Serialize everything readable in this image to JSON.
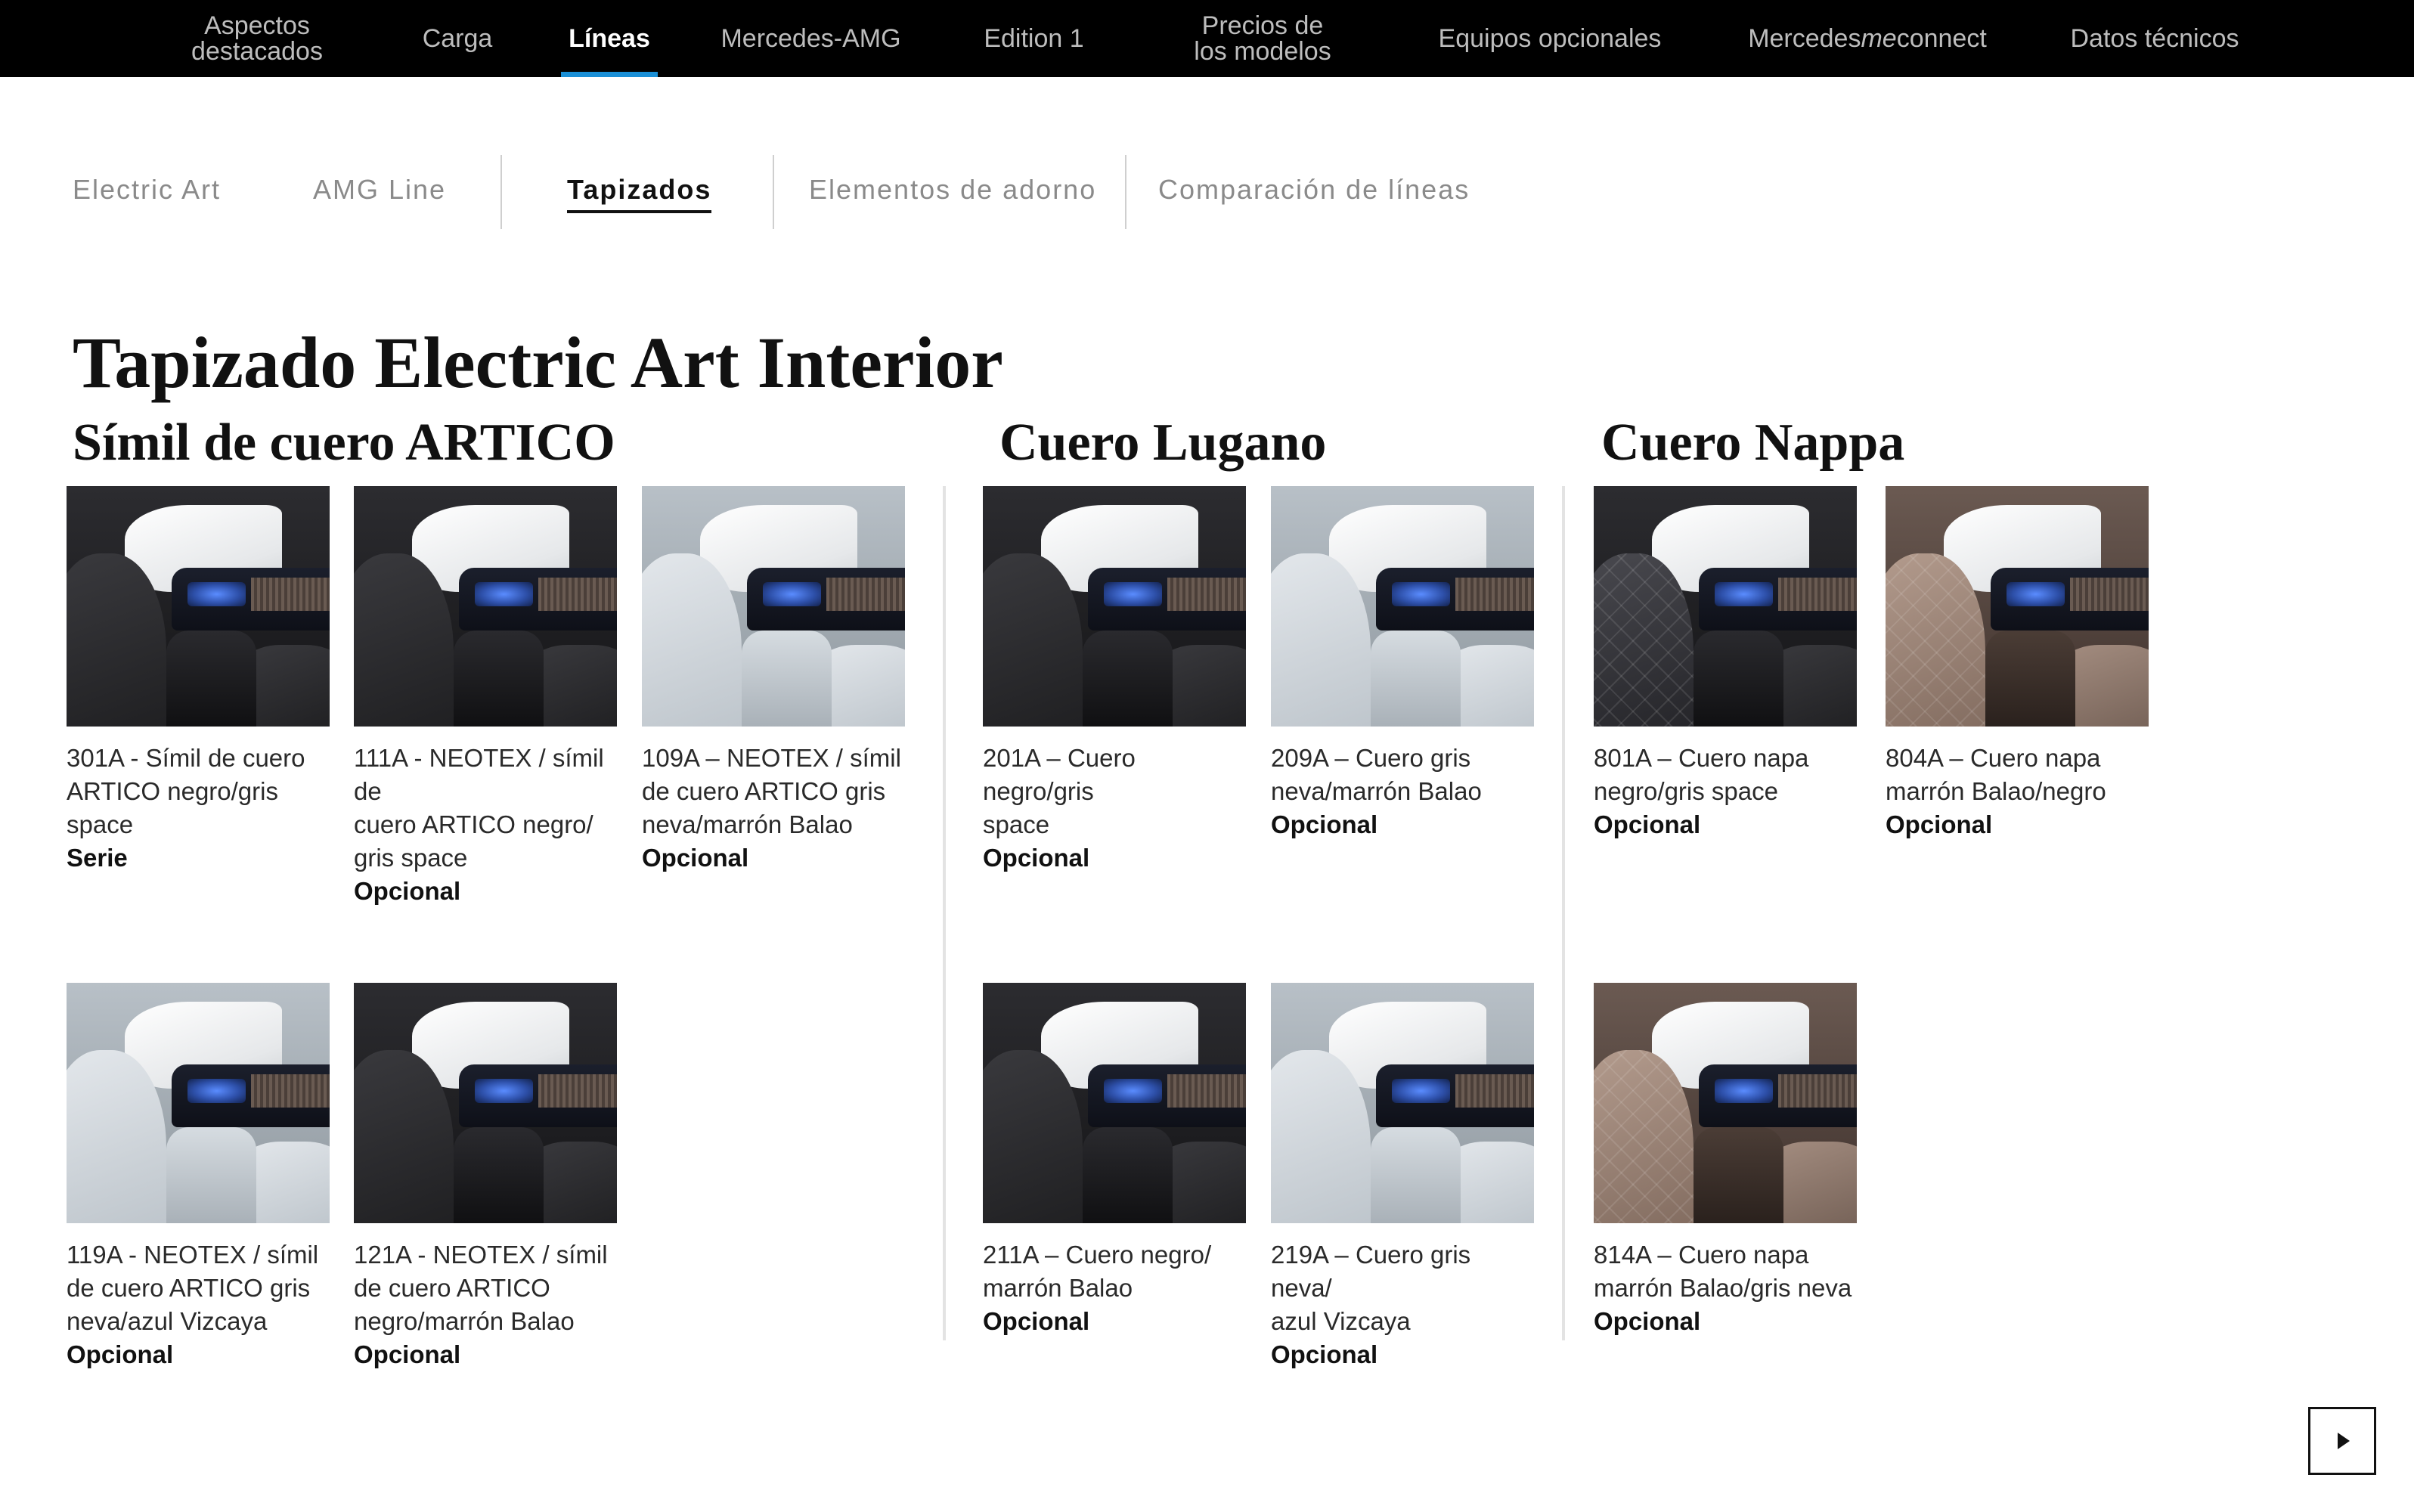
{
  "topnav": {
    "items": [
      {
        "label": "Aspectos\ndestacados"
      },
      {
        "label": "Carga"
      },
      {
        "label": "Líneas"
      },
      {
        "label": "Mercedes-AMG"
      },
      {
        "label": "Edition 1"
      },
      {
        "label": "Precios de\nlos modelos"
      },
      {
        "label": "Equipos opcionales"
      },
      {
        "label_pre": "Mercedes ",
        "label_em": "me",
        "label_post": " connect"
      },
      {
        "label": "Datos técnicos"
      }
    ],
    "active": "Líneas"
  },
  "subtabs": {
    "items": [
      "Electric Art",
      "AMG Line",
      "Tapizados",
      "Elementos de adorno",
      "Comparación de líneas"
    ],
    "active": "Tapizados"
  },
  "page_title": "Tapizado Electric Art Interior",
  "sections": [
    {
      "title": "Símil de cuero ARTICO",
      "cards": [
        {
          "desc": "301A - Símil de cuero\nARTICO negro/gris\nspace",
          "status": "Serie",
          "tone": "dark"
        },
        {
          "desc": "111A - NEOTEX / símil de\ncuero ARTICO negro/\ngris space",
          "status": "Opcional",
          "tone": "dark"
        },
        {
          "desc": "109A – NEOTEX / símil\nde cuero ARTICO gris\nneva/marrón Balao",
          "status": "Opcional",
          "tone": "light"
        },
        {
          "desc": "119A - NEOTEX / símil\nde cuero ARTICO gris\nneva/azul Vizcaya",
          "status": "Opcional",
          "tone": "light"
        },
        {
          "desc": "121A - NEOTEX / símil\nde cuero ARTICO\nnegro/marrón Balao",
          "status": "Opcional",
          "tone": "dark"
        }
      ]
    },
    {
      "title": "Cuero Lugano",
      "cards": [
        {
          "desc": "201A – Cuero negro/gris\nspace",
          "status": "Opcional",
          "tone": "dark"
        },
        {
          "desc": "209A  – Cuero gris\nneva/marrón Balao",
          "status": "Opcional",
          "tone": "light"
        },
        {
          "desc": "211A – Cuero negro/\nmarrón Balao",
          "status": "Opcional",
          "tone": "dark"
        },
        {
          "desc": "219A – Cuero gris neva/\nazul Vizcaya",
          "status": "Opcional",
          "tone": "light"
        }
      ]
    },
    {
      "title": "Cuero Nappa",
      "cards": [
        {
          "desc": "801A – Cuero napa\nnegro/gris space",
          "status": "Opcional",
          "tone": "dark"
        },
        {
          "desc": "804A – Cuero napa\nmarrón Balao/negro",
          "status": "Opcional",
          "tone": "brown"
        },
        {
          "desc": "814A – Cuero napa\nmarrón Balao/gris neva",
          "status": "Opcional",
          "tone": "brown"
        }
      ]
    }
  ],
  "colors": {
    "nav_bg": "#000000",
    "nav_active_underline": "#1a8fd6",
    "divider": "#e3e3e3"
  },
  "icons": {
    "next": "play-icon"
  }
}
